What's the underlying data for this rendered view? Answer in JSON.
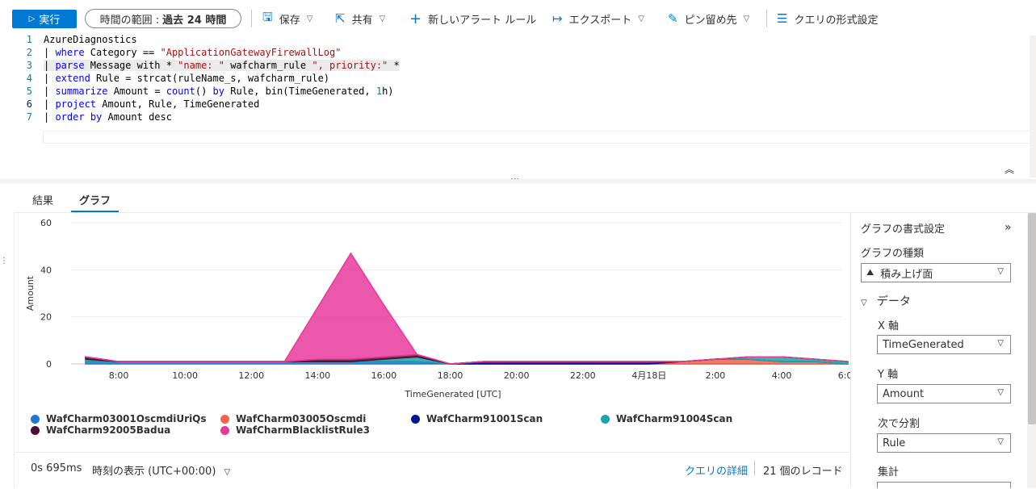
{
  "toolbar": {
    "run_label": "実行",
    "time_range_label": "時間の範囲 :",
    "time_range_value": "過去 24 時間",
    "save_label": "保存",
    "share_label": "共有",
    "new_alert_label": "新しいアラート ルール",
    "export_label": "エクスポート",
    "pin_label": "ピン留め先",
    "format_query_label": "クエリの形式設定"
  },
  "editor": {
    "line_numbers": [
      "1",
      "2",
      "3",
      "4",
      "5",
      "6",
      "7"
    ],
    "lines": [
      "AzureDiagnostics",
      "| where Category == \"ApplicationGatewayFirewallLog\"",
      "| parse Message with * \"name: \" wafcharm_rule \", priority:\" *",
      "| extend Rule = strcat(ruleName_s, wafcharm_rule)",
      "| summarize Amount = count() by Rule, bin(TimeGenerated, 1h)",
      "| project Amount, Rule, TimeGenerated",
      "| order by Amount desc"
    ]
  },
  "tabs": {
    "results": "結果",
    "chart": "グラフ"
  },
  "chart_data": {
    "type": "area",
    "stacked": true,
    "xlabel": "TimeGenerated [UTC]",
    "ylabel": "Amount",
    "ylim": [
      0,
      60
    ],
    "yticks": [
      "0",
      "20",
      "40",
      "60"
    ],
    "xticks": [
      "8:00",
      "10:00",
      "12:00",
      "14:00",
      "16:00",
      "18:00",
      "20:00",
      "22:00",
      "4月18日",
      "2:00",
      "4:00",
      "6:00"
    ],
    "x": [
      "7:00",
      "8:00",
      "9:00",
      "10:00",
      "11:00",
      "12:00",
      "13:00",
      "14:00",
      "15:00",
      "16:00",
      "17:00",
      "18:00",
      "19:00",
      "20:00",
      "21:00",
      "22:00",
      "23:00",
      "0:00",
      "1:00",
      "2:00",
      "3:00",
      "4:00",
      "5:00",
      "6:00"
    ],
    "series": [
      {
        "name": "WafCharm03001OscmdiUriQs",
        "color": "#1f77d4",
        "values": [
          1,
          1,
          1,
          1,
          1,
          1,
          1,
          1,
          1,
          1,
          1,
          0,
          0,
          0,
          0,
          0,
          0,
          0,
          0,
          0,
          0,
          0,
          0,
          0
        ]
      },
      {
        "name": "WafCharm03005Oscmdi",
        "color": "#f0644a",
        "values": [
          0,
          0,
          0,
          0,
          0,
          0,
          0,
          0,
          0,
          0,
          0,
          0,
          0,
          0,
          0,
          0,
          0,
          0,
          1,
          2,
          2,
          1,
          1,
          0
        ]
      },
      {
        "name": "WafCharm91001Scan",
        "color": "#00188f",
        "values": [
          0,
          0,
          0,
          0,
          0,
          0,
          0,
          0,
          0,
          0,
          0,
          0,
          1,
          1,
          1,
          1,
          1,
          1,
          0,
          0,
          0,
          0,
          0,
          0
        ]
      },
      {
        "name": "WafCharm91004Scan",
        "color": "#1ba3a8",
        "values": [
          1,
          0,
          0,
          0,
          0,
          0,
          0,
          0,
          0,
          1,
          2,
          0,
          0,
          0,
          0,
          0,
          0,
          0,
          0,
          0,
          1,
          2,
          1,
          1
        ]
      },
      {
        "name": "WafCharm92005Badua",
        "color": "#4b0f32",
        "values": [
          1,
          0,
          0,
          0,
          0,
          0,
          0,
          1,
          1,
          1,
          1,
          0,
          0,
          0,
          0,
          0,
          0,
          0,
          0,
          0,
          0,
          0,
          0,
          0
        ]
      },
      {
        "name": "WafCharmBlacklistRule3",
        "color": "#e8399b",
        "values": [
          0,
          0,
          0,
          0,
          0,
          0,
          0,
          22,
          45,
          22,
          0,
          0,
          0,
          0,
          0,
          0,
          0,
          0,
          0,
          0,
          0,
          0,
          0,
          0
        ]
      }
    ]
  },
  "status": {
    "elapsed": "0s 695ms",
    "time_display": "時刻の表示 (UTC+00:00)",
    "query_details": "クエリの詳細",
    "record_count": "21 個のレコード"
  },
  "panel": {
    "title": "グラフの書式設定",
    "chart_type_label": "グラフの種類",
    "chart_type_value": "積み上げ面",
    "data_section": "データ",
    "x_axis_label": "X 軸",
    "x_axis_value": "TimeGenerated",
    "y_axis_label": "Y 軸",
    "y_axis_value": "Amount",
    "split_label": "次で分割",
    "split_value": "Rule",
    "aggregate_label": "集計"
  }
}
